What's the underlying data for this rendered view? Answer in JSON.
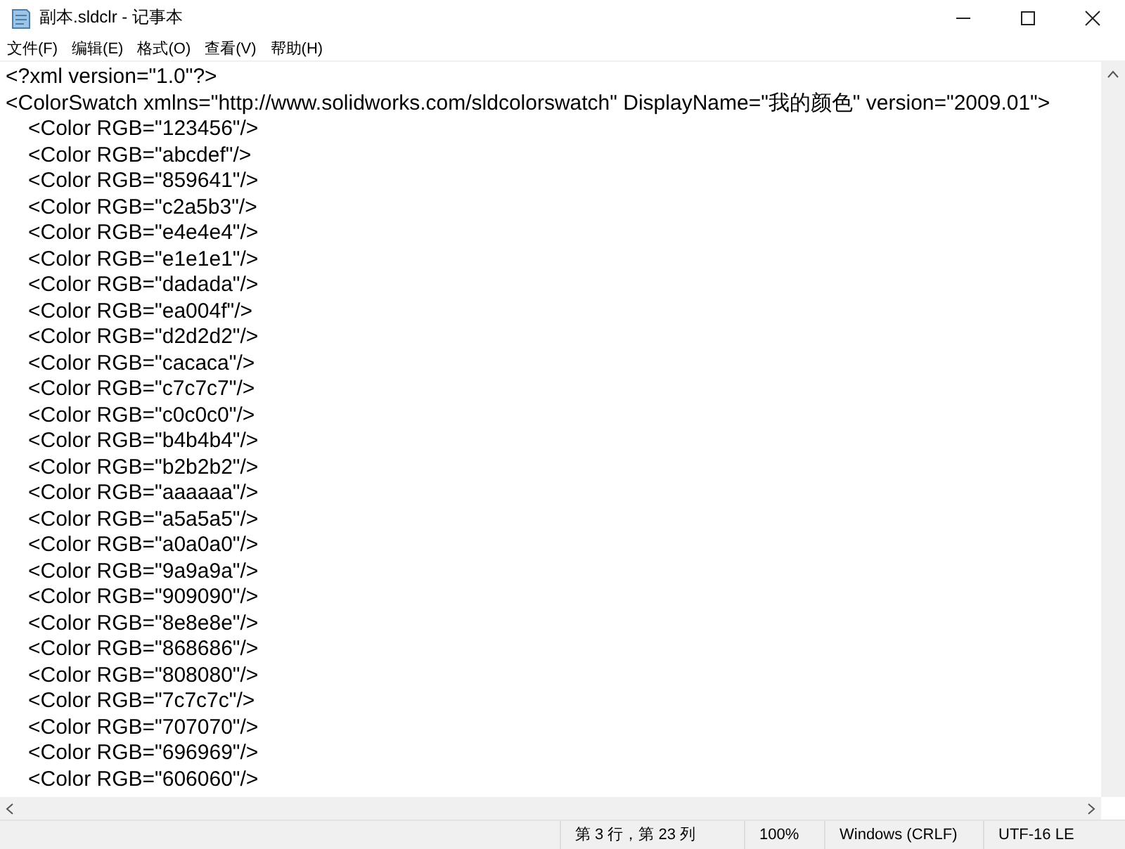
{
  "window": {
    "title": "副本.sldclr - 记事本"
  },
  "menu": [
    "文件(F)",
    "编辑(E)",
    "格式(O)",
    "查看(V)",
    "帮助(H)"
  ],
  "document": {
    "lines": [
      {
        "text": "<?xml version=\"1.0\"?>"
      },
      {
        "text": "<ColorSwatch xmlns=\"http://www.solidworks.com/sldcolorswatch\" DisplayName=\"我的颜色\" version=\"2009.01\">",
        "children": [
          {
            "text": "<Color RGB=\"123456\"/>"
          },
          {
            "text": "<Color RGB=\"abcdef\"/>"
          },
          {
            "text": "<Color RGB=\"859641\"/>"
          },
          {
            "text": "<Color RGB=\"c2a5b3\"/>"
          },
          {
            "text": "<Color RGB=\"e4e4e4\"/>"
          },
          {
            "text": "<Color RGB=\"e1e1e1\"/>"
          },
          {
            "text": "<Color RGB=\"dadada\"/>"
          },
          {
            "text": "<Color RGB=\"ea004f\"/>"
          },
          {
            "text": "<Color RGB=\"d2d2d2\"/>"
          },
          {
            "text": "<Color RGB=\"cacaca\"/>"
          },
          {
            "text": "<Color RGB=\"c7c7c7\"/>"
          },
          {
            "text": "<Color RGB=\"c0c0c0\"/>"
          },
          {
            "text": "<Color RGB=\"b4b4b4\"/>"
          },
          {
            "text": "<Color RGB=\"b2b2b2\"/>"
          },
          {
            "text": "<Color RGB=\"aaaaaa\"/>"
          },
          {
            "text": "<Color RGB=\"a5a5a5\"/>"
          },
          {
            "text": "<Color RGB=\"a0a0a0\"/>"
          },
          {
            "text": "<Color RGB=\"9a9a9a\"/>"
          },
          {
            "text": "<Color RGB=\"909090\"/>"
          },
          {
            "text": "<Color RGB=\"8e8e8e\"/>"
          },
          {
            "text": "<Color RGB=\"868686\"/>"
          },
          {
            "text": "<Color RGB=\"808080\"/>"
          },
          {
            "text": "<Color RGB=\"7c7c7c\"/>"
          },
          {
            "text": "<Color RGB=\"707070\"/>"
          },
          {
            "text": "<Color RGB=\"696969\"/>"
          },
          {
            "text": "<Color RGB=\"606060\"/>"
          }
        ]
      }
    ]
  },
  "status_bar": [
    "第 3 行，第 23 列",
    "100%",
    "Windows (CRLF)",
    "UTF-16 LE"
  ]
}
